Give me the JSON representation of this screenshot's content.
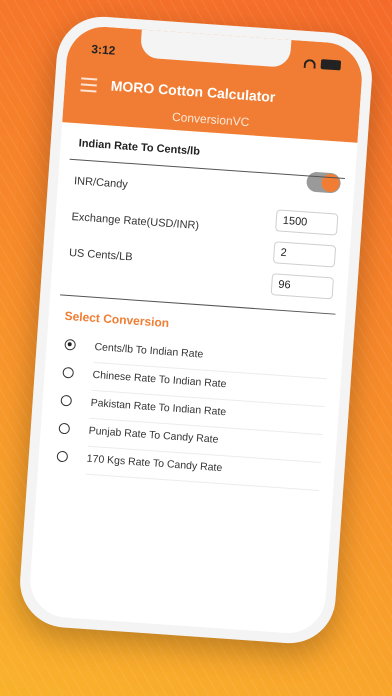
{
  "status": {
    "time": "3:12"
  },
  "header": {
    "title": "MORO Cotton Calculator",
    "subtitle": "ConversionVC"
  },
  "section": {
    "title": "Indian Rate To Cents/lb"
  },
  "fields": {
    "inr_candy": {
      "label": "INR/Candy",
      "value": "1500"
    },
    "exchange_rate": {
      "label": "Exchange Rate(USD/INR)",
      "value": "2"
    },
    "us_cents_lb": {
      "label": "US Cents/LB",
      "value": "96"
    }
  },
  "select_conversion": {
    "title": "Select Conversion",
    "options": [
      {
        "label": "Cents/lb To Indian Rate",
        "checked": true
      },
      {
        "label": "Chinese Rate To Indian Rate",
        "checked": false
      },
      {
        "label": "Pakistan Rate To Indian Rate",
        "checked": false
      },
      {
        "label": "Punjab Rate To Candy Rate",
        "checked": false
      },
      {
        "label": "170 Kgs Rate To Candy Rate",
        "checked": false
      }
    ]
  },
  "colors": {
    "accent": "#f07d33",
    "background_gradient_start": "#f56a2a",
    "background_gradient_end": "#f9b22c"
  }
}
